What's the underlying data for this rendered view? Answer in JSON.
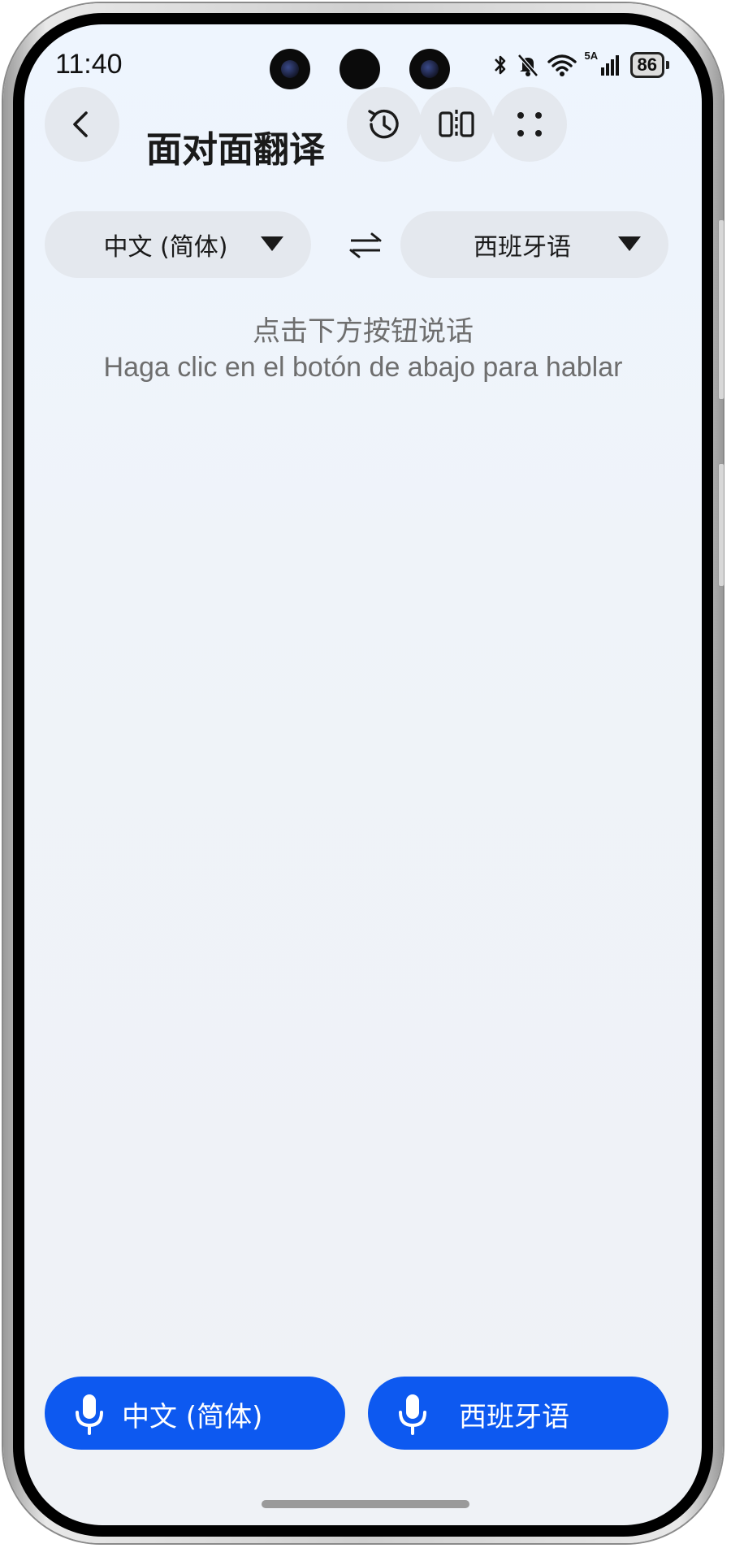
{
  "status_bar": {
    "time": "11:40",
    "network_label": "5A",
    "battery": "86",
    "icons": [
      "bluetooth-icon",
      "mute-bell-icon",
      "wifi-icon",
      "signal-icon",
      "battery-icon"
    ]
  },
  "header": {
    "title": "面对面翻译",
    "actions": [
      "history-icon",
      "split-view-icon",
      "more-dots-icon"
    ]
  },
  "languages": {
    "source": "中文 (简体)",
    "target": "西班牙语"
  },
  "hint": {
    "zh": "点击下方按钮说话",
    "es": "Haga clic en el botón de abajo para hablar"
  },
  "mic_buttons": {
    "left_label": "中文 (简体)",
    "right_label": "西班牙语"
  },
  "colors": {
    "accent": "#0d59f0",
    "background": "#eff3f9",
    "pill": "#e4e8ee"
  }
}
